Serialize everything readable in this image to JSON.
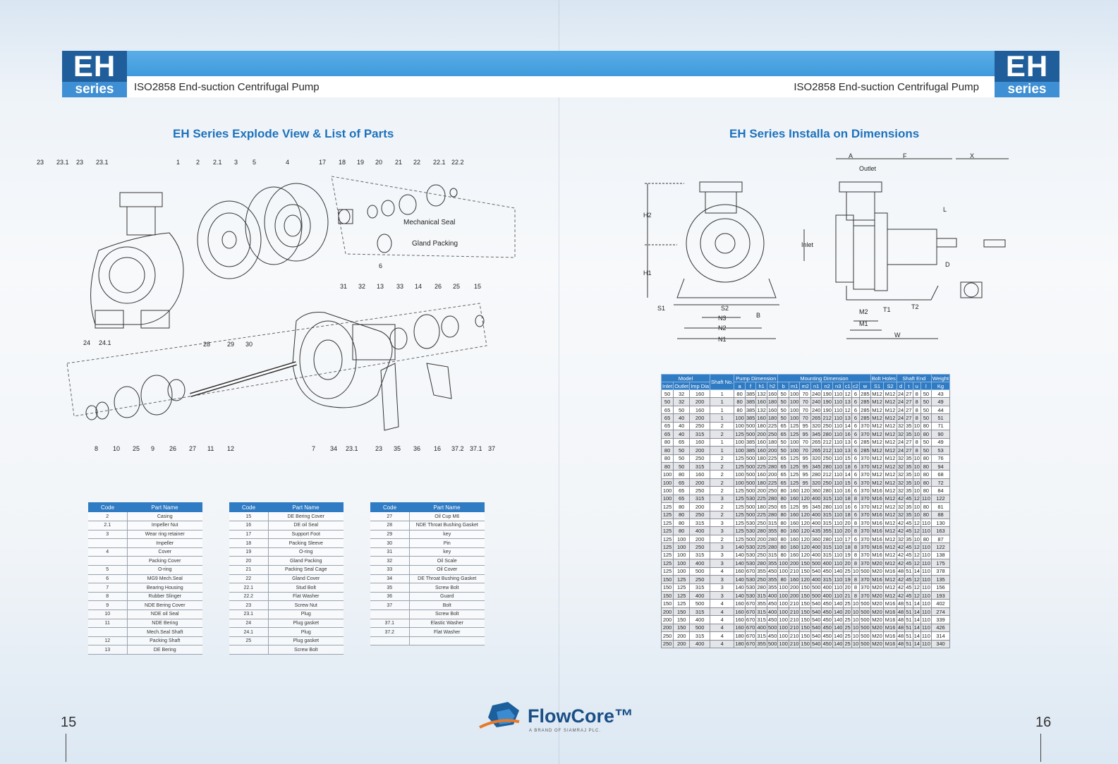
{
  "header": {
    "badge_big": "EH",
    "badge_small": "series",
    "subtitle_left": "ISO2858 End-suction Centrifugal Pump",
    "subtitle_right": "ISO2858 End-suction Centrifugal Pump"
  },
  "left_page": {
    "title": "EH Series Explode View & List of Parts",
    "page_number": "15",
    "callouts_top": [
      "23",
      "23.1",
      "23",
      "23.1",
      "1",
      "2",
      "2.1",
      "3",
      "5",
      "4",
      "17",
      "18",
      "19",
      "20",
      "21",
      "22",
      "22.1",
      "22.2"
    ],
    "callouts_mid": [
      "31",
      "32",
      "13",
      "33",
      "14",
      "26",
      "25",
      "15",
      "28",
      "29",
      "30",
      "24",
      "24.1",
      "6"
    ],
    "callouts_bottom": [
      "8",
      "10",
      "25",
      "9",
      "26",
      "27",
      "11",
      "12",
      "7",
      "34",
      "23.1",
      "23",
      "35",
      "36",
      "16",
      "37.2",
      "37.1",
      "37"
    ],
    "labels": {
      "mech_seal": "Mechanical Seal",
      "gland_packing": "Gland Packing"
    },
    "table_header": {
      "code": "Code",
      "part": "Part Name"
    },
    "table1": [
      [
        "2",
        "Casing"
      ],
      [
        "2.1",
        "Impeller Nut"
      ],
      [
        "3",
        "Wear ring retainer"
      ],
      [
        "",
        "Impeller"
      ],
      [
        "4",
        "Cover"
      ],
      [
        "",
        "Packing Cover"
      ],
      [
        "5",
        "O-ring"
      ],
      [
        "6",
        "MG9 Mech.Seal"
      ],
      [
        "7",
        "Bearing Housing"
      ],
      [
        "8",
        "Rubber Slinger"
      ],
      [
        "9",
        "NDE Bering Cover"
      ],
      [
        "10",
        "NDE oil Seal"
      ],
      [
        "11",
        "NDE Bering"
      ],
      [
        "",
        "Mech.Seal Shaft"
      ],
      [
        "12",
        "Packing Shaft"
      ],
      [
        "13",
        "DE Bering"
      ]
    ],
    "table2": [
      [
        "15",
        "DE Bering Cover"
      ],
      [
        "16",
        "DE oil Seal"
      ],
      [
        "17",
        "Support Foot"
      ],
      [
        "18",
        "Packing Sleeve"
      ],
      [
        "19",
        "O-ring"
      ],
      [
        "20",
        "Gland Packing"
      ],
      [
        "21",
        "Packing Seal Cage"
      ],
      [
        "22",
        "Gland Cover"
      ],
      [
        "22.1",
        "Stud Bolt"
      ],
      [
        "22.2",
        "Flat Washer"
      ],
      [
        "23",
        "Screw Nut"
      ],
      [
        "23.1",
        "Plug"
      ],
      [
        "24",
        "Plug gasket"
      ],
      [
        "24.1",
        "Plug"
      ],
      [
        "25",
        "Plug gasket"
      ],
      [
        "",
        "Screw Bolt"
      ]
    ],
    "table3": [
      [
        "27",
        "Oil Cup M6"
      ],
      [
        "28",
        "NDE Throat Bushing Gasket"
      ],
      [
        "29",
        "key"
      ],
      [
        "30",
        "Pin"
      ],
      [
        "31",
        "key"
      ],
      [
        "32",
        "Oil Scale"
      ],
      [
        "33",
        "Oil Cover"
      ],
      [
        "34",
        "DE Throat Bushing Gasket"
      ],
      [
        "35",
        "Screw Bolt"
      ],
      [
        "36",
        "Guard"
      ],
      [
        "37",
        "Bolt"
      ],
      [
        "",
        "Screw Bolt"
      ],
      [
        "37.1",
        "Elastic Washer"
      ],
      [
        "37.2",
        "Flat Washer"
      ],
      [
        "",
        ""
      ]
    ]
  },
  "right_page": {
    "title": "EH Series Installa on Dimensions",
    "page_number": "16",
    "dim_labels": [
      "A",
      "F",
      "X",
      "Outlet",
      "L",
      "H2",
      "H1",
      "Inlet",
      "D",
      "S1",
      "S2",
      "N3",
      "N2",
      "N1",
      "B",
      "M2",
      "M1",
      "T1",
      "T2",
      "W"
    ],
    "table_groups": [
      "Model",
      "Shaft No.",
      "Pump Dimension",
      "Mounting Dimension",
      "Bolt Holes",
      "Shaft End",
      "Weight"
    ],
    "table_subheaders": [
      "Inlet",
      "Outlet",
      "Imp Dia",
      "a",
      "f",
      "h1",
      "h2",
      "b",
      "m1",
      "m2",
      "n1",
      "n2",
      "n3",
      "c1",
      "c2",
      "w",
      "S1",
      "S2",
      "d",
      "t",
      "u",
      "l",
      "Kg"
    ],
    "rows": [
      [
        "50",
        "32",
        "160",
        "1",
        "80",
        "385",
        "132",
        "160",
        "50",
        "100",
        "70",
        "240",
        "190",
        "110",
        "12",
        "6",
        "285",
        "M12",
        "M12",
        "24",
        "27",
        "8",
        "50",
        "43"
      ],
      [
        "50",
        "32",
        "200",
        "1",
        "80",
        "385",
        "160",
        "180",
        "50",
        "100",
        "70",
        "240",
        "190",
        "110",
        "13",
        "6",
        "285",
        "M12",
        "M12",
        "24",
        "27",
        "8",
        "50",
        "49"
      ],
      [
        "65",
        "50",
        "160",
        "1",
        "80",
        "385",
        "132",
        "160",
        "50",
        "100",
        "70",
        "240",
        "190",
        "110",
        "12",
        "6",
        "285",
        "M12",
        "M12",
        "24",
        "27",
        "8",
        "50",
        "44"
      ],
      [
        "65",
        "40",
        "200",
        "1",
        "100",
        "385",
        "160",
        "180",
        "50",
        "100",
        "70",
        "265",
        "212",
        "110",
        "13",
        "6",
        "285",
        "M12",
        "M12",
        "24",
        "27",
        "8",
        "50",
        "51"
      ],
      [
        "65",
        "40",
        "250",
        "2",
        "100",
        "500",
        "180",
        "225",
        "65",
        "125",
        "95",
        "320",
        "250",
        "110",
        "14",
        "6",
        "370",
        "M12",
        "M12",
        "32",
        "35",
        "10",
        "80",
        "71"
      ],
      [
        "65",
        "40",
        "315",
        "2",
        "125",
        "500",
        "200",
        "250",
        "65",
        "125",
        "95",
        "345",
        "280",
        "110",
        "16",
        "6",
        "370",
        "M12",
        "M12",
        "32",
        "35",
        "10",
        "80",
        "90"
      ],
      [
        "80",
        "65",
        "160",
        "1",
        "100",
        "385",
        "160",
        "180",
        "50",
        "100",
        "70",
        "265",
        "212",
        "110",
        "13",
        "6",
        "285",
        "M12",
        "M12",
        "24",
        "27",
        "8",
        "50",
        "49"
      ],
      [
        "80",
        "50",
        "200",
        "1",
        "100",
        "385",
        "160",
        "200",
        "50",
        "100",
        "70",
        "265",
        "212",
        "110",
        "13",
        "6",
        "285",
        "M12",
        "M12",
        "24",
        "27",
        "8",
        "50",
        "53"
      ],
      [
        "80",
        "50",
        "250",
        "2",
        "125",
        "500",
        "180",
        "225",
        "65",
        "125",
        "95",
        "320",
        "250",
        "110",
        "15",
        "6",
        "370",
        "M12",
        "M12",
        "32",
        "35",
        "10",
        "80",
        "76"
      ],
      [
        "80",
        "50",
        "315",
        "2",
        "125",
        "500",
        "225",
        "280",
        "65",
        "125",
        "95",
        "345",
        "280",
        "110",
        "18",
        "6",
        "370",
        "M12",
        "M12",
        "32",
        "35",
        "10",
        "80",
        "94"
      ],
      [
        "100",
        "80",
        "160",
        "2",
        "100",
        "500",
        "160",
        "200",
        "65",
        "125",
        "95",
        "280",
        "212",
        "110",
        "14",
        "6",
        "370",
        "M12",
        "M12",
        "32",
        "35",
        "10",
        "80",
        "68"
      ],
      [
        "100",
        "65",
        "200",
        "2",
        "100",
        "500",
        "180",
        "225",
        "65",
        "125",
        "95",
        "320",
        "250",
        "110",
        "15",
        "6",
        "370",
        "M12",
        "M12",
        "32",
        "35",
        "10",
        "80",
        "72"
      ],
      [
        "100",
        "65",
        "250",
        "2",
        "125",
        "500",
        "200",
        "250",
        "80",
        "160",
        "120",
        "360",
        "280",
        "110",
        "16",
        "6",
        "370",
        "M16",
        "M12",
        "32",
        "35",
        "10",
        "80",
        "84"
      ],
      [
        "100",
        "65",
        "315",
        "3",
        "125",
        "530",
        "225",
        "280",
        "80",
        "160",
        "120",
        "400",
        "315",
        "110",
        "18",
        "8",
        "370",
        "M16",
        "M12",
        "42",
        "45",
        "12",
        "110",
        "122"
      ],
      [
        "125",
        "80",
        "200",
        "2",
        "125",
        "500",
        "180",
        "250",
        "65",
        "125",
        "95",
        "345",
        "280",
        "110",
        "16",
        "6",
        "370",
        "M12",
        "M12",
        "32",
        "35",
        "10",
        "80",
        "81"
      ],
      [
        "125",
        "80",
        "250",
        "2",
        "125",
        "500",
        "225",
        "280",
        "80",
        "160",
        "120",
        "400",
        "315",
        "110",
        "18",
        "6",
        "370",
        "M16",
        "M12",
        "32",
        "35",
        "10",
        "80",
        "88"
      ],
      [
        "125",
        "80",
        "315",
        "3",
        "125",
        "530",
        "250",
        "315",
        "80",
        "160",
        "120",
        "400",
        "315",
        "110",
        "20",
        "8",
        "370",
        "M16",
        "M12",
        "42",
        "45",
        "12",
        "110",
        "130"
      ],
      [
        "125",
        "80",
        "400",
        "3",
        "125",
        "530",
        "280",
        "355",
        "80",
        "160",
        "120",
        "435",
        "355",
        "110",
        "20",
        "8",
        "370",
        "M16",
        "M12",
        "42",
        "45",
        "12",
        "110",
        "163"
      ],
      [
        "125",
        "100",
        "200",
        "2",
        "125",
        "500",
        "200",
        "280",
        "80",
        "160",
        "120",
        "360",
        "280",
        "110",
        "17",
        "6",
        "370",
        "M16",
        "M12",
        "32",
        "35",
        "10",
        "80",
        "87"
      ],
      [
        "125",
        "100",
        "250",
        "3",
        "140",
        "530",
        "225",
        "280",
        "80",
        "160",
        "120",
        "400",
        "315",
        "110",
        "18",
        "8",
        "370",
        "M16",
        "M12",
        "42",
        "45",
        "12",
        "110",
        "122"
      ],
      [
        "125",
        "100",
        "315",
        "3",
        "140",
        "530",
        "250",
        "315",
        "80",
        "160",
        "120",
        "400",
        "315",
        "110",
        "19",
        "8",
        "370",
        "M16",
        "M12",
        "42",
        "45",
        "12",
        "110",
        "138"
      ],
      [
        "125",
        "100",
        "400",
        "3",
        "140",
        "530",
        "280",
        "355",
        "100",
        "200",
        "150",
        "500",
        "400",
        "110",
        "20",
        "8",
        "370",
        "M20",
        "M12",
        "42",
        "45",
        "12",
        "110",
        "175"
      ],
      [
        "125",
        "100",
        "500",
        "4",
        "160",
        "670",
        "355",
        "450",
        "100",
        "210",
        "150",
        "540",
        "450",
        "140",
        "25",
        "10",
        "500",
        "M20",
        "M16",
        "48",
        "51",
        "14",
        "110",
        "378"
      ],
      [
        "150",
        "125",
        "250",
        "3",
        "140",
        "530",
        "250",
        "355",
        "80",
        "160",
        "120",
        "400",
        "315",
        "110",
        "19",
        "8",
        "370",
        "M16",
        "M12",
        "42",
        "45",
        "12",
        "110",
        "135"
      ],
      [
        "150",
        "125",
        "315",
        "3",
        "140",
        "530",
        "280",
        "355",
        "100",
        "200",
        "150",
        "500",
        "400",
        "110",
        "20",
        "8",
        "370",
        "M20",
        "M12",
        "42",
        "45",
        "12",
        "110",
        "156"
      ],
      [
        "150",
        "125",
        "400",
        "3",
        "140",
        "530",
        "315",
        "400",
        "100",
        "200",
        "150",
        "500",
        "400",
        "110",
        "21",
        "8",
        "370",
        "M20",
        "M12",
        "42",
        "45",
        "12",
        "110",
        "193"
      ],
      [
        "150",
        "125",
        "500",
        "4",
        "160",
        "670",
        "355",
        "450",
        "100",
        "210",
        "150",
        "540",
        "450",
        "140",
        "25",
        "10",
        "500",
        "M20",
        "M16",
        "48",
        "51",
        "14",
        "110",
        "402"
      ],
      [
        "200",
        "150",
        "315",
        "4",
        "160",
        "670",
        "315",
        "400",
        "100",
        "210",
        "150",
        "540",
        "450",
        "140",
        "20",
        "10",
        "500",
        "M20",
        "M16",
        "48",
        "51",
        "14",
        "110",
        "274"
      ],
      [
        "200",
        "150",
        "400",
        "4",
        "160",
        "670",
        "315",
        "450",
        "100",
        "210",
        "150",
        "540",
        "450",
        "140",
        "25",
        "10",
        "500",
        "M20",
        "M16",
        "48",
        "51",
        "14",
        "110",
        "339"
      ],
      [
        "200",
        "150",
        "500",
        "4",
        "160",
        "670",
        "400",
        "500",
        "100",
        "210",
        "150",
        "540",
        "450",
        "140",
        "25",
        "10",
        "500",
        "M20",
        "M16",
        "48",
        "51",
        "14",
        "110",
        "426"
      ],
      [
        "250",
        "200",
        "315",
        "4",
        "180",
        "670",
        "315",
        "450",
        "100",
        "210",
        "150",
        "540",
        "450",
        "140",
        "25",
        "10",
        "500",
        "M20",
        "M16",
        "48",
        "51",
        "14",
        "110",
        "314"
      ],
      [
        "250",
        "200",
        "400",
        "4",
        "180",
        "670",
        "355",
        "500",
        "100",
        "210",
        "150",
        "540",
        "450",
        "140",
        "25",
        "10",
        "500",
        "M20",
        "M16",
        "48",
        "51",
        "14",
        "110",
        "340"
      ]
    ]
  },
  "footer": {
    "brand": "FlowCore™",
    "tagline": "A BRAND OF SIAMRAJ PLC."
  },
  "colors": {
    "accent": "#2f7bc4",
    "title": "#1d72bd",
    "badge": "#1f5e9a"
  }
}
